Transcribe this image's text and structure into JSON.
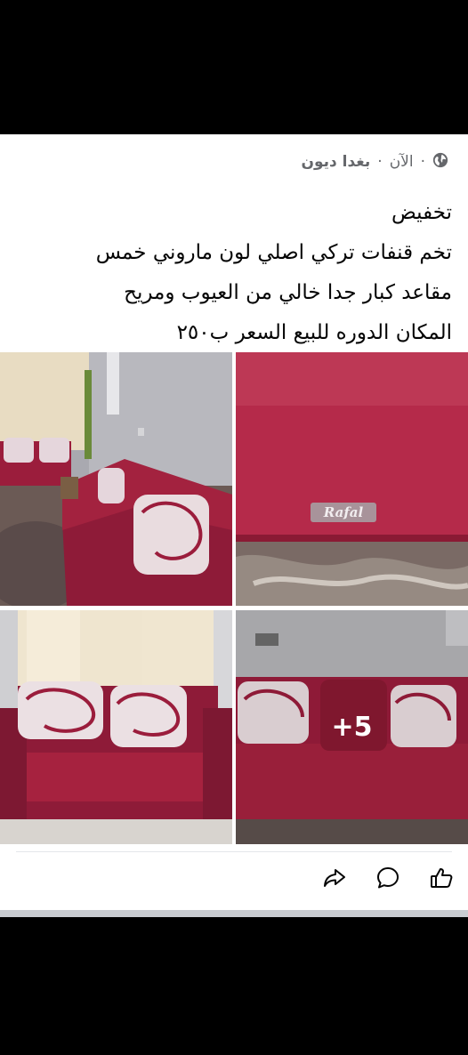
{
  "post": {
    "author": "بغدا ديون",
    "time": "الآن",
    "separator": "·",
    "visibility_icon": "globe-icon",
    "text_lines": [
      "تخفيض",
      "تخم قنفات تركي اصلي لون ماروني خمس",
      "مقاعد كبار جدا خالي من العيوب ومريح",
      "المكان الدوره للبيع السعر ب٢٥٠"
    ],
    "photos": [
      {
        "name": "sofa-living-room-photo"
      },
      {
        "name": "fabric-closeup-photo",
        "brand": "Rafal"
      },
      {
        "name": "loveseat-photo"
      },
      {
        "name": "sofa-cushions-photo",
        "more_label": "+5"
      }
    ]
  },
  "actions": {
    "like_icon": "thumbs-up-icon",
    "comment_icon": "comment-icon",
    "share_icon": "share-icon"
  },
  "colors": {
    "maroon": "#9b1d3c",
    "text": "#050505",
    "meta": "#65676b"
  }
}
